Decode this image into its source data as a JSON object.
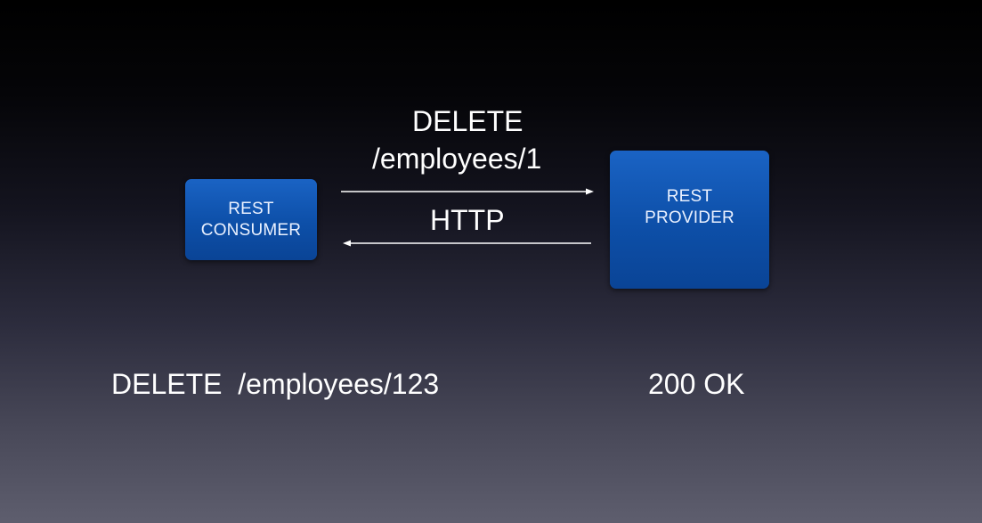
{
  "diagram": {
    "consumer": {
      "line1": "REST",
      "line2": "CONSUMER"
    },
    "provider": {
      "line1": "REST",
      "line2": "PROVIDER"
    },
    "request": {
      "method": "DELETE",
      "path": "/employees/1"
    },
    "protocol": "HTTP"
  },
  "example": {
    "request": "DELETE  /employees/123",
    "response": "200 OK"
  },
  "colors": {
    "box": "#0d4fa8",
    "text": "#ffffff"
  }
}
